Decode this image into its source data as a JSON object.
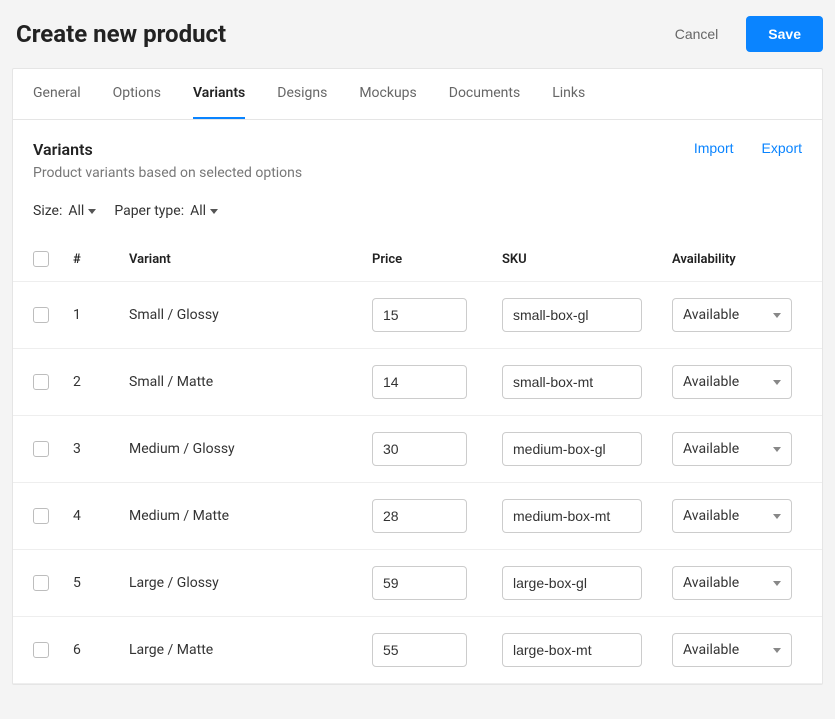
{
  "header": {
    "title": "Create new product",
    "cancel_label": "Cancel",
    "save_label": "Save"
  },
  "tabs": [
    {
      "label": "General"
    },
    {
      "label": "Options"
    },
    {
      "label": "Variants",
      "active": true
    },
    {
      "label": "Designs"
    },
    {
      "label": "Mockups"
    },
    {
      "label": "Documents"
    },
    {
      "label": "Links"
    }
  ],
  "section": {
    "title": "Variants",
    "subtitle": "Product variants based on selected options",
    "import_label": "Import",
    "export_label": "Export"
  },
  "filters": {
    "size_label": "Size:",
    "size_value": "All",
    "paper_label": "Paper type:",
    "paper_value": "All"
  },
  "columns": {
    "num": "#",
    "variant": "Variant",
    "price": "Price",
    "sku": "SKU",
    "availability": "Availability"
  },
  "rows": [
    {
      "num": "1",
      "variant": "Small / Glossy",
      "price": "15",
      "sku": "small-box-gl",
      "availability": "Available"
    },
    {
      "num": "2",
      "variant": "Small / Matte",
      "price": "14",
      "sku": "small-box-mt",
      "availability": "Available"
    },
    {
      "num": "3",
      "variant": "Medium / Glossy",
      "price": "30",
      "sku": "medium-box-gl",
      "availability": "Available"
    },
    {
      "num": "4",
      "variant": "Medium / Matte",
      "price": "28",
      "sku": "medium-box-mt",
      "availability": "Available"
    },
    {
      "num": "5",
      "variant": "Large / Glossy",
      "price": "59",
      "sku": "large-box-gl",
      "availability": "Available"
    },
    {
      "num": "6",
      "variant": "Large / Matte",
      "price": "55",
      "sku": "large-box-mt",
      "availability": "Available"
    }
  ]
}
